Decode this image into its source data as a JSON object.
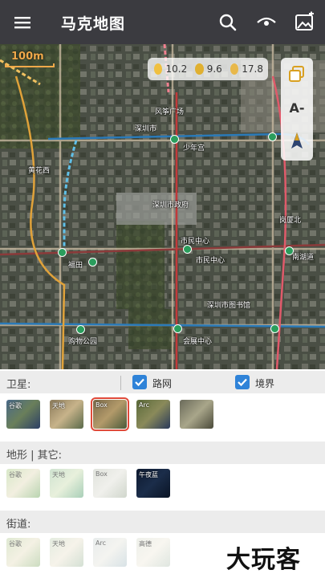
{
  "app": {
    "title": "马克地图"
  },
  "icons": {
    "menu": "menu-icon",
    "search": "search-icon",
    "eye": "eye-icon",
    "image": "image-icon",
    "layers": "layers-icon",
    "font": "font-size-icon",
    "compass": "compass-icon"
  },
  "map": {
    "scale_label": "100m",
    "weather": {
      "v1": "10.2",
      "v2": "9.6",
      "v3": "17.8"
    },
    "font_button": "A-",
    "labels": {
      "kite_square": "风筝广场",
      "shenzhen_art": "深圳市",
      "youth": "少年宫",
      "huanghua": "黄花西",
      "gov": "深圳市政府",
      "civic": "市民中心",
      "citizen_center": "市民中心",
      "futian": "福田",
      "huizhan": "会展中心",
      "shopping": "购物公园",
      "library": "深圳市图书馆",
      "gangxia": "岗厦北",
      "nanhu": "南湖道"
    }
  },
  "panel": {
    "satellite": {
      "label": "卫星:",
      "road_label": "路网",
      "boundary_label": "境界",
      "thumbs": [
        "谷歌",
        "天地",
        "Box",
        "Arc",
        ""
      ]
    },
    "terrain": {
      "label": "地形 | 其它:",
      "thumbs": [
        "谷歌",
        "天地",
        "Box",
        "午夜蓝"
      ]
    },
    "street": {
      "label": "街道:",
      "thumbs": [
        "谷歌",
        "天地",
        "Arc",
        "高德"
      ]
    }
  },
  "watermark": "大玩客",
  "colors": {
    "appbar": "#3b3b40",
    "checkbox": "#2f83d8",
    "selected": "#e04a3a",
    "metro": "#2a9d5c"
  }
}
